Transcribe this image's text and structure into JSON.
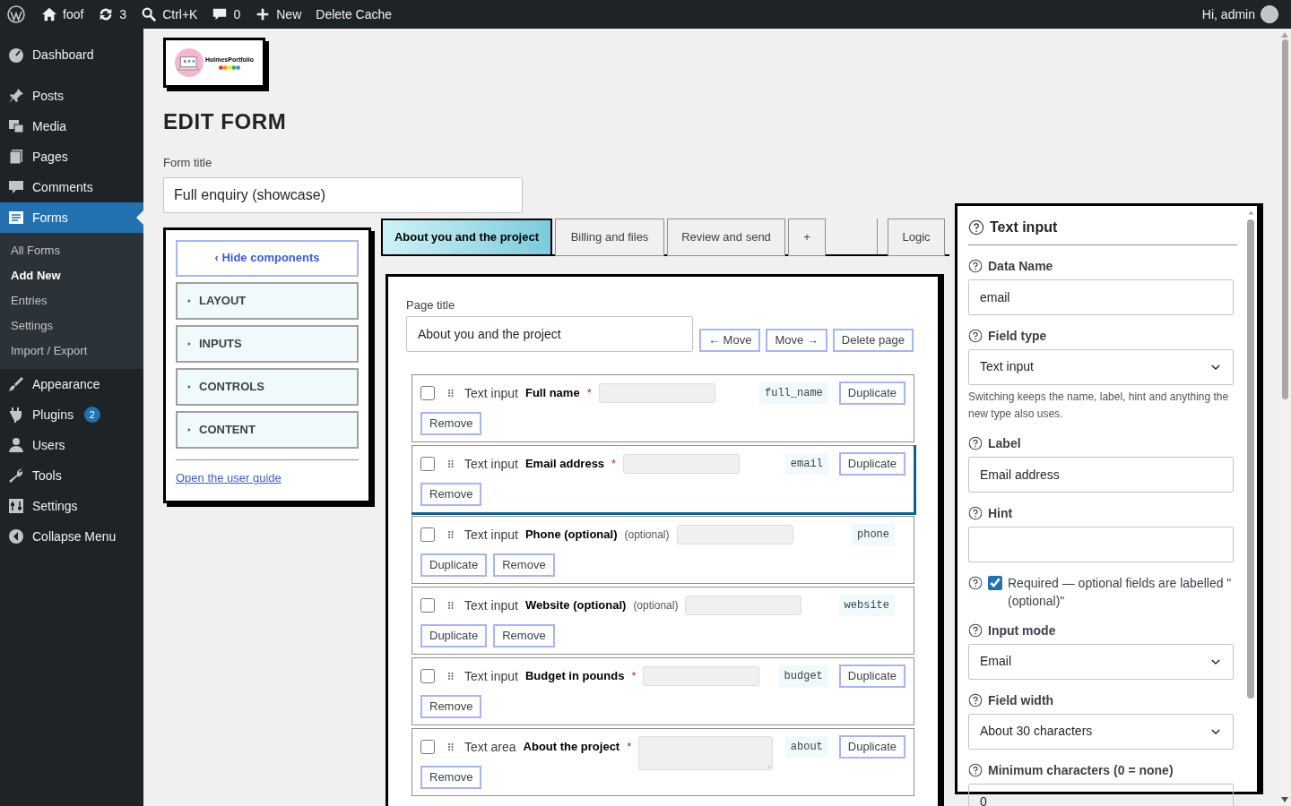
{
  "admin_bar": {
    "items": [
      {
        "label": "foof"
      },
      {
        "label": "3"
      },
      {
        "label": "Ctrl+K"
      },
      {
        "label": "0"
      },
      {
        "label": "New"
      },
      {
        "label": "Delete Cache"
      }
    ],
    "greeting": "Hi, admin"
  },
  "sidebar": {
    "items": [
      {
        "label": "Dashboard",
        "selected": false
      },
      {
        "label": "Posts",
        "selected": false
      },
      {
        "label": "Media",
        "selected": false
      },
      {
        "label": "Pages",
        "selected": false
      },
      {
        "label": "Comments",
        "selected": false
      },
      {
        "label": "Forms",
        "selected": true,
        "children": [
          {
            "label": "All Forms",
            "selected": false
          },
          {
            "label": "Add New",
            "selected": true
          },
          {
            "label": "Entries",
            "selected": false
          },
          {
            "label": "Settings",
            "selected": false
          },
          {
            "label": "Import / Export",
            "selected": false
          }
        ]
      },
      {
        "label": "Appearance",
        "selected": false
      },
      {
        "label": "Plugins",
        "selected": false,
        "badge": "2"
      },
      {
        "label": "Users",
        "selected": false
      },
      {
        "label": "Tools",
        "selected": false
      },
      {
        "label": "Settings",
        "selected": false
      }
    ],
    "collapse": "Collapse Menu"
  },
  "logo": {
    "text": "HolmesPortfolio"
  },
  "heading": "EDIT FORM",
  "form_title": {
    "label": "Form title",
    "value": "Full enquiry (showcase)"
  },
  "components": {
    "hide_button": "‹ Hide components",
    "sections": [
      {
        "label": "LAYOUT",
        "expanded": false
      },
      {
        "label": "INPUTS",
        "expanded": false
      },
      {
        "label": "CONTROLS",
        "expanded": false
      },
      {
        "label": "CONTENT",
        "expanded": false
      }
    ],
    "guide_link": "Open the user guide"
  },
  "tabs": [
    {
      "label": "About you and the project",
      "selected": true
    },
    {
      "label": "Billing and files",
      "selected": false
    },
    {
      "label": "Review and send",
      "selected": false
    },
    {
      "label": "+",
      "selected": false
    }
  ],
  "logic_tab": "Logic",
  "page": {
    "title_label": "Page title",
    "title_value": "About you and the project",
    "buttons": [
      "← Move",
      "Move →",
      "Delete page"
    ],
    "fields": [
      {
        "kind": "input",
        "type": "Text input",
        "label": "Full name",
        "required_mark": "*",
        "data_name": "full_name",
        "selected": false,
        "checked": false,
        "buttons": [
          "Duplicate",
          "Remove"
        ]
      },
      {
        "kind": "input",
        "type": "Text input",
        "label": "Email address",
        "required_mark": "*",
        "data_name": "email",
        "selected": true,
        "checked": false,
        "buttons": [
          "Duplicate",
          "Remove"
        ]
      },
      {
        "kind": "input",
        "type": "Text input",
        "label": "Phone (optional)",
        "optional_tag": "(optional)",
        "data_name": "phone",
        "selected": false,
        "checked": false,
        "buttons": [
          "Duplicate",
          "Remove"
        ]
      },
      {
        "kind": "input",
        "type": "Text input",
        "label": "Website (optional)",
        "optional_tag": "(optional)",
        "data_name": "website",
        "selected": false,
        "checked": false,
        "buttons": [
          "Duplicate",
          "Remove"
        ]
      },
      {
        "kind": "input",
        "type": "Text input",
        "label": "Budget in pounds",
        "required_mark": "*",
        "data_name": "budget",
        "selected": false,
        "checked": false,
        "buttons": [
          "Duplicate",
          "Remove"
        ]
      },
      {
        "kind": "textarea",
        "type": "Text area",
        "label": "About the project",
        "required_mark": "*",
        "data_name": "about",
        "selected": false,
        "checked": false,
        "buttons": [
          "Duplicate",
          "Remove"
        ]
      }
    ]
  },
  "inspector": {
    "title": "Text input",
    "settings": [
      {
        "kind": "input",
        "label": "Data Name",
        "value": "email"
      },
      {
        "kind": "select",
        "label": "Field type",
        "value": "Text input",
        "note": "Switching keeps the name, label, hint and anything the new type also uses."
      },
      {
        "kind": "input",
        "label": "Label",
        "value": "Email address"
      },
      {
        "kind": "input",
        "label": "Hint"
      },
      {
        "kind": "checkbox",
        "label": "Required — optional fields are labelled \"(optional)\"",
        "checked": true
      },
      {
        "kind": "select",
        "label": "Input mode",
        "value": "Email"
      },
      {
        "kind": "select",
        "label": "Field width",
        "value": "About 30 characters"
      },
      {
        "kind": "input",
        "label": "Minimum characters (0 = none)",
        "value": "0"
      }
    ]
  }
}
